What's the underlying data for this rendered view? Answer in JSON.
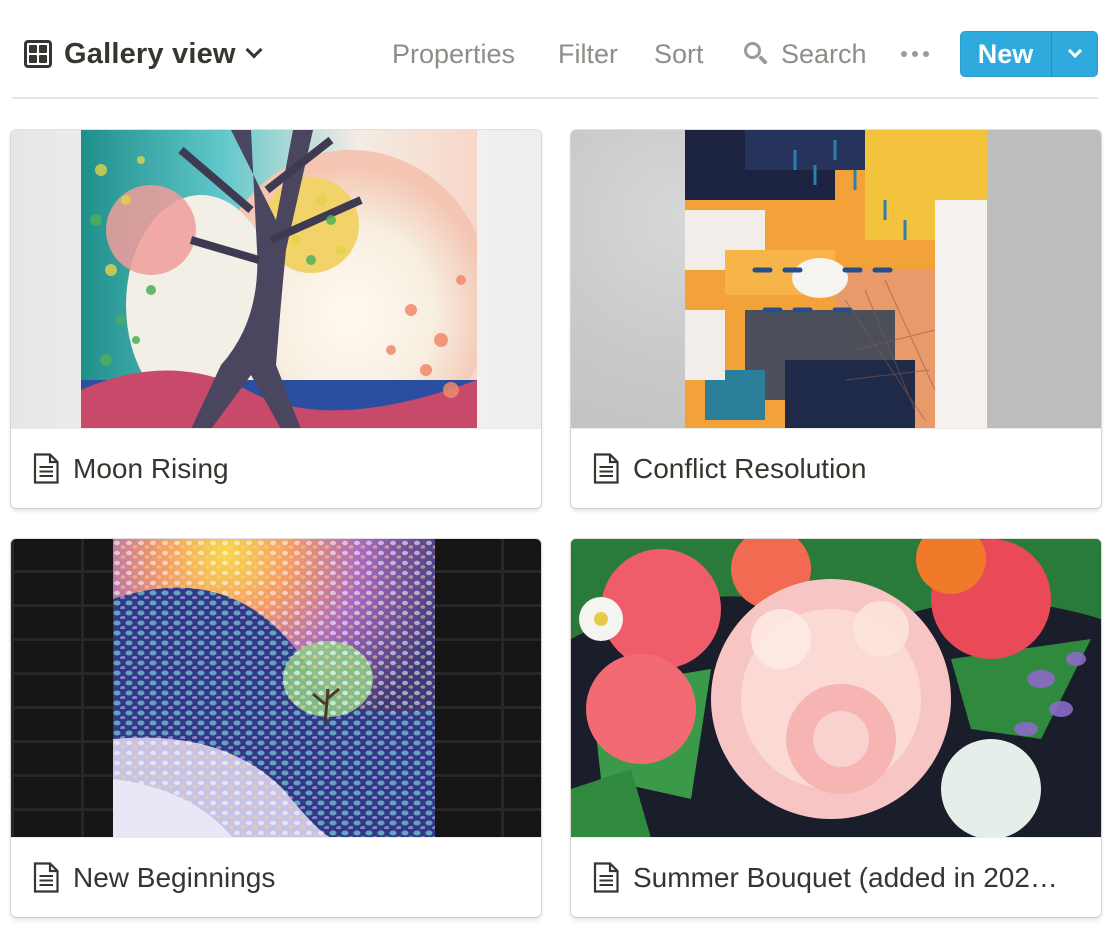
{
  "toolbar": {
    "view_label": "Gallery view",
    "properties_label": "Properties",
    "filter_label": "Filter",
    "sort_label": "Sort",
    "search_label": "Search",
    "new_label": "New",
    "accent_color": "#2eaadc"
  },
  "gallery": {
    "cards": [
      {
        "title": "Moon Rising",
        "icon": "page-icon"
      },
      {
        "title": "Conflict Resolution",
        "icon": "page-icon"
      },
      {
        "title": "New Beginnings",
        "icon": "page-icon"
      },
      {
        "title": "Summer Bouquet (added in 202…",
        "icon": "page-icon"
      }
    ]
  }
}
